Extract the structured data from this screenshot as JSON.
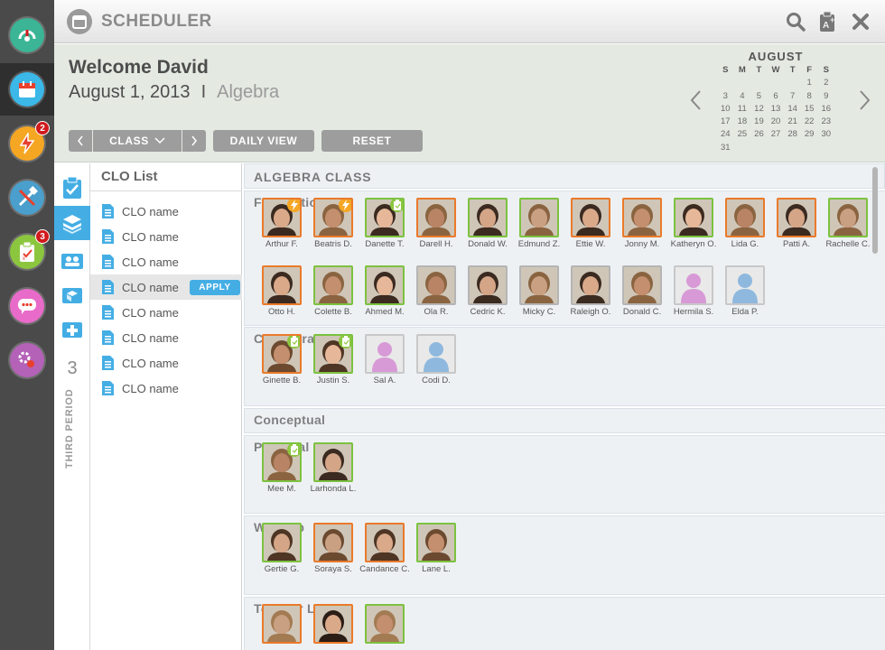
{
  "app": {
    "title": "SCHEDULER"
  },
  "header": {
    "welcome": "Welcome David",
    "date": "August 1, 2013",
    "separator": "I",
    "subject": "Algebra"
  },
  "controls": {
    "class_label": "CLASS",
    "daily_view_label": "DAILY VIEW",
    "reset_label": "RESET"
  },
  "calendar": {
    "month": "AUGUST",
    "weekdays": [
      "S",
      "M",
      "T",
      "W",
      "T",
      "F",
      "S"
    ],
    "weeks": [
      [
        "",
        "",
        "",
        "",
        "",
        "1",
        "2"
      ],
      [
        "3",
        "4",
        "5",
        "6",
        "7",
        "8",
        "9"
      ],
      [
        "10",
        "11",
        "12",
        "13",
        "14",
        "15",
        "16"
      ],
      [
        "17",
        "18",
        "19",
        "20",
        "21",
        "22",
        "23"
      ],
      [
        "24",
        "25",
        "26",
        "27",
        "28",
        "29",
        "30"
      ],
      [
        "31",
        "",
        "",
        "",
        "",
        "",
        ""
      ]
    ]
  },
  "rail": {
    "items": [
      {
        "icon": "gauge-icon",
        "color": "#3bb596"
      },
      {
        "icon": "calendar-icon",
        "color": "#3bb7e8",
        "active": true
      },
      {
        "icon": "lightning-icon",
        "color": "#f5a623",
        "badge": "2"
      },
      {
        "icon": "tools-icon",
        "color": "#4a9fcc"
      },
      {
        "icon": "clipboard-icon",
        "color": "#8cc63f",
        "badge": "3"
      },
      {
        "icon": "chat-icon",
        "color": "#e86bc9"
      },
      {
        "icon": "settings-icon",
        "color": "#b461b8"
      }
    ]
  },
  "period": {
    "number": "3",
    "label": "THIRD PERIOD"
  },
  "clo": {
    "title": "CLO List",
    "items": [
      "CLO name",
      "CLO name",
      "CLO name",
      "CLO name",
      "CLO name",
      "CLO name",
      "CLO name",
      "CLO name"
    ],
    "selected_index": 3,
    "apply_label": "APPLY"
  },
  "main": {
    "title": "ALGEBRA CLASS",
    "sections": [
      {
        "title": "Foundational",
        "students": [
          {
            "name": "Arthur F.",
            "border": "orange",
            "badge": "lightning"
          },
          {
            "name": "Beatris D.",
            "border": "orange",
            "badge": "lightning"
          },
          {
            "name": "Danette T.",
            "border": "green",
            "badge": "clipboard"
          },
          {
            "name": "Darell H.",
            "border": "orange"
          },
          {
            "name": "Donald W.",
            "border": "green"
          },
          {
            "name": "Edmund Z.",
            "border": "green"
          },
          {
            "name": "Ettie W.",
            "border": "orange"
          },
          {
            "name": "Jonny M.",
            "border": "orange"
          },
          {
            "name": "Katheryn O.",
            "border": "green"
          },
          {
            "name": "Lida G.",
            "border": "orange"
          },
          {
            "name": "Patti A.",
            "border": "orange"
          },
          {
            "name": "Rachelle C.",
            "border": "green"
          },
          {
            "name": "Otto H.",
            "border": "orange"
          },
          {
            "name": "Colette B.",
            "border": "green"
          },
          {
            "name": "Ahmed M.",
            "border": "green"
          },
          {
            "name": "Ola R.",
            "border": "gray"
          },
          {
            "name": "Cedric K.",
            "border": "gray"
          },
          {
            "name": "Micky C.",
            "border": "gray"
          },
          {
            "name": "Raleigh O.",
            "border": "gray"
          },
          {
            "name": "Donald C.",
            "border": "gray"
          },
          {
            "name": "Hermila S.",
            "border": "gray",
            "placeholder": "female"
          },
          {
            "name": "Elda P.",
            "border": "gray",
            "placeholder": "male"
          }
        ]
      },
      {
        "title": "Collaborative",
        "students": [
          {
            "name": "Ginette B.",
            "border": "orange",
            "badge": "clipboard"
          },
          {
            "name": "Justin S.",
            "border": "green",
            "badge": "clipboard"
          },
          {
            "name": "Sal A.",
            "border": "gray",
            "placeholder": "female"
          },
          {
            "name": "Codi D.",
            "border": "gray",
            "placeholder": "male"
          }
        ]
      },
      {
        "title": "Conceptual",
        "students": []
      },
      {
        "title": "Personal",
        "students": [
          {
            "name": "Mee M.",
            "border": "green",
            "badge": "clipboard"
          },
          {
            "name": "Larhonda L.",
            "border": "green"
          }
        ]
      },
      {
        "title": "Wet Lab",
        "students": [
          {
            "name": "Gertie G.",
            "border": "green"
          },
          {
            "name": "Soraya S.",
            "border": "orange"
          },
          {
            "name": "Candance C.",
            "border": "orange"
          },
          {
            "name": "Lane L.",
            "border": "green"
          }
        ]
      },
      {
        "title": "Teacher Led",
        "students": [
          {
            "name": "",
            "border": "orange"
          },
          {
            "name": "",
            "border": "orange"
          },
          {
            "name": "",
            "border": "green"
          }
        ]
      }
    ]
  },
  "colors": {
    "orange": "#ea7a2a",
    "green": "#7cc23f",
    "gray": "#b5b5b5",
    "accent": "#44aee4"
  }
}
